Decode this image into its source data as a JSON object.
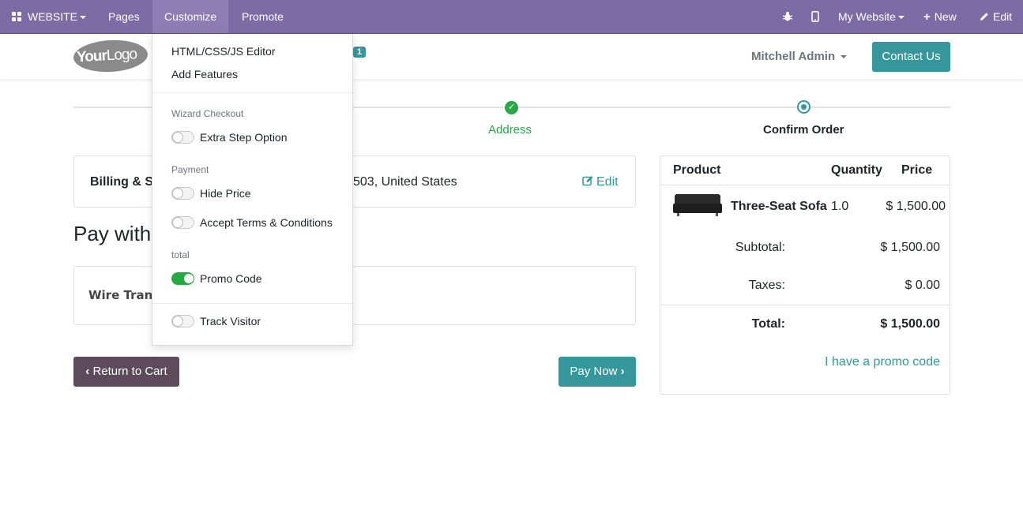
{
  "topbar": {
    "website_label": "WEBSITE",
    "pages_label": "Pages",
    "customize_label": "Customize",
    "promote_label": "Promote",
    "my_website_label": "My Website",
    "new_label": "New",
    "edit_label": "Edit",
    "icons": [
      "grid-icon",
      "bug-icon",
      "mobile-icon",
      "plus-icon",
      "pencil-icon"
    ]
  },
  "header": {
    "logo_text_bold": "Your",
    "logo_text": "Logo",
    "cart_count": "1",
    "user_name": "Mitchell Admin",
    "contact_label": "Contact Us"
  },
  "wizard": {
    "step_done": "Address",
    "step_current": "Confirm Order"
  },
  "billing": {
    "label": "Billing & Sh",
    "address_tail": "503, United States",
    "edit_label": "Edit"
  },
  "payment": {
    "title": "Pay with",
    "wire_label": "Wire Trans"
  },
  "buttons": {
    "return_label": "Return to Cart",
    "pay_label": "Pay Now"
  },
  "summary": {
    "col_product": "Product",
    "col_quantity": "Quantity",
    "col_price": "Price",
    "item_name": "Three-Seat Sofa",
    "item_qty": "1.0",
    "item_price": "$ 1,500.00",
    "subtotal_label": "Subtotal:",
    "subtotal_value": "$ 1,500.00",
    "taxes_label": "Taxes:",
    "taxes_value": "$ 0.00",
    "total_label": "Total:",
    "total_value": "$ 1,500.00",
    "promo_link": "I have a promo code"
  },
  "customize_menu": {
    "editor": "HTML/CSS/JS Editor",
    "add_features": "Add Features",
    "section_wizard": "Wizard Checkout",
    "extra_step": "Extra Step Option",
    "section_payment": "Payment",
    "hide_price": "Hide Price",
    "accept_terms": "Accept Terms & Conditions",
    "section_total": "total",
    "promo_code": "Promo Code",
    "track_visitor": "Track Visitor",
    "toggles": {
      "extra_step": false,
      "hide_price": false,
      "accept_terms": false,
      "promo_code": true,
      "track_visitor": false
    }
  },
  "colors": {
    "admin_bar": "#7c6ba5",
    "primary": "#35979c",
    "success": "#28a745",
    "secondary_btn": "#5d4a5a"
  }
}
